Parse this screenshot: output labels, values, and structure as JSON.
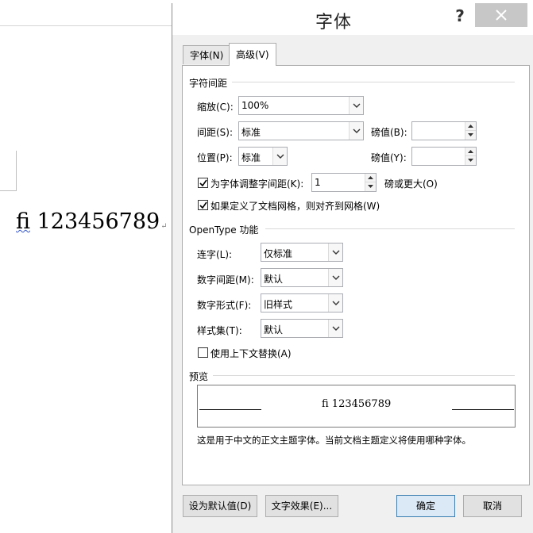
{
  "document": {
    "sample_ligature": "fi",
    "sample_text": " 123456789",
    "pilcrow": "↵"
  },
  "dialog": {
    "title": "字体",
    "help": "?",
    "tabs": [
      {
        "label": "字体(N)",
        "active": false
      },
      {
        "label": "高级(V)",
        "active": true
      }
    ],
    "char_spacing": {
      "title": "字符间距",
      "scale_label": "缩放(C):",
      "scale_value": "100%",
      "spacing_label": "间距(S):",
      "spacing_value": "标准",
      "spacing_pt_label": "磅值(B):",
      "spacing_pt_value": "",
      "position_label": "位置(P):",
      "position_value": "标准",
      "position_pt_label": "磅值(Y):",
      "position_pt_value": "",
      "kerning_label": "为字体调整字间距(K):",
      "kerning_checked": true,
      "kerning_value": "1",
      "kerning_suffix": "磅或更大(O)",
      "grid_label": "如果定义了文档网格，则对齐到网格(W)",
      "grid_checked": true
    },
    "opentype": {
      "title": "OpenType 功能",
      "ligatures_label": "连字(L):",
      "ligatures_value": "仅标准",
      "num_spacing_label": "数字间距(M):",
      "num_spacing_value": "默认",
      "num_forms_label": "数字形式(F):",
      "num_forms_value": "旧样式",
      "stylistic_label": "样式集(T):",
      "stylistic_value": "默认",
      "contextual_label": "使用上下文替换(A)",
      "contextual_checked": false
    },
    "preview": {
      "title": "预览",
      "sample": "ﬁ 123456789",
      "description": "这是用于中文的正文主题字体。当前文档主题定义将使用哪种字体。"
    },
    "buttons": {
      "set_default": "设为默认值(D)",
      "text_effects": "文字效果(E)...",
      "ok": "确定",
      "cancel": "取消"
    }
  },
  "colors": {
    "dialog_bg": "#f0f0f0",
    "close_bg": "#c7c7c7",
    "ok_border": "#3c7fb1"
  }
}
